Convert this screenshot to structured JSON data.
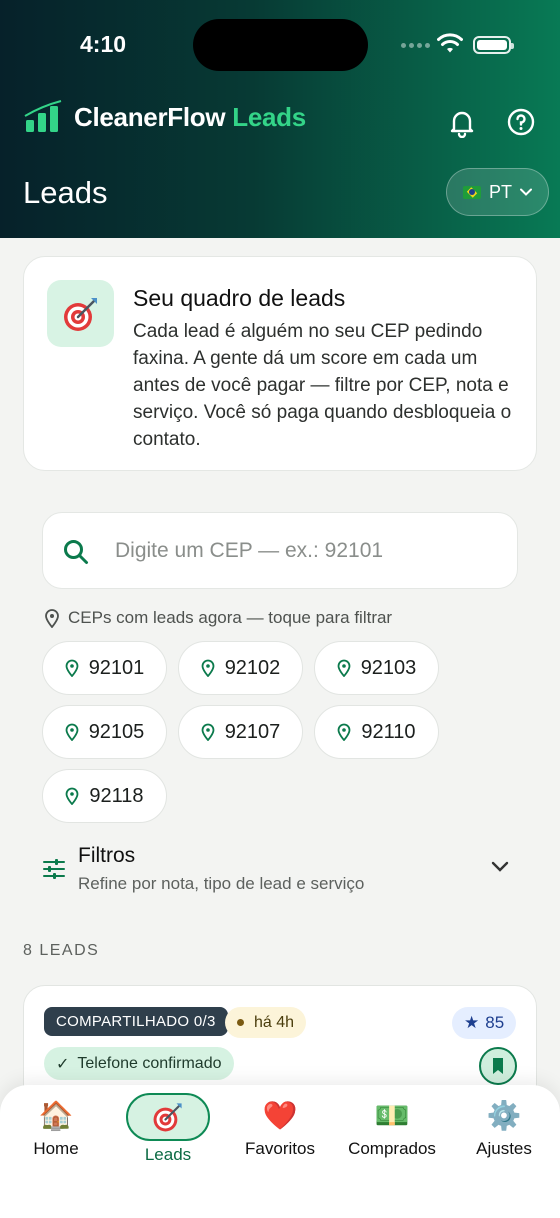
{
  "status_bar": {
    "time": "4:10"
  },
  "header": {
    "brand_main": "CleanerFlow",
    "brand_accent": "Leads",
    "title": "Leads",
    "language": "PT",
    "icons": [
      "bell-icon",
      "help-icon"
    ]
  },
  "intro": {
    "title": "Seu quadro de leads",
    "body": "Cada lead é alguém no seu CEP pedindo faxina. A gente dá um score em cada um antes de você pagar — filtre por CEP, nota e serviço. Você só paga quando desbloqueia o contato."
  },
  "search": {
    "placeholder": "Digite um CEP — ex.: 92101",
    "value": ""
  },
  "cep_hint": "CEPs com leads agora — toque para filtrar",
  "ceps": [
    "92101",
    "92102",
    "92103",
    "92105",
    "92107",
    "92110",
    "92118"
  ],
  "filters": {
    "title": "Filtros",
    "subtitle": "Refine por nota, tipo de lead e serviço"
  },
  "lead_count": "8 LEADS",
  "lead_card": {
    "shared": "COMPARTILHADO 0/3",
    "time": "há 4h",
    "score": "85",
    "verified": "Telefone confirmado"
  },
  "nav": {
    "items": [
      {
        "label": "Home",
        "icon": "🏠"
      },
      {
        "label": "Leads",
        "icon": "🎯"
      },
      {
        "label": "Favoritos",
        "icon": "❤️"
      },
      {
        "label": "Comprados",
        "icon": "💵"
      },
      {
        "label": "Ajustes",
        "icon": "⚙️"
      }
    ],
    "active": "Leads"
  },
  "colors": {
    "brand_green": "#0b7a4c",
    "accent_green": "#33d488",
    "header_dark": "#06212a",
    "score_blue": "#1e3f8f"
  }
}
